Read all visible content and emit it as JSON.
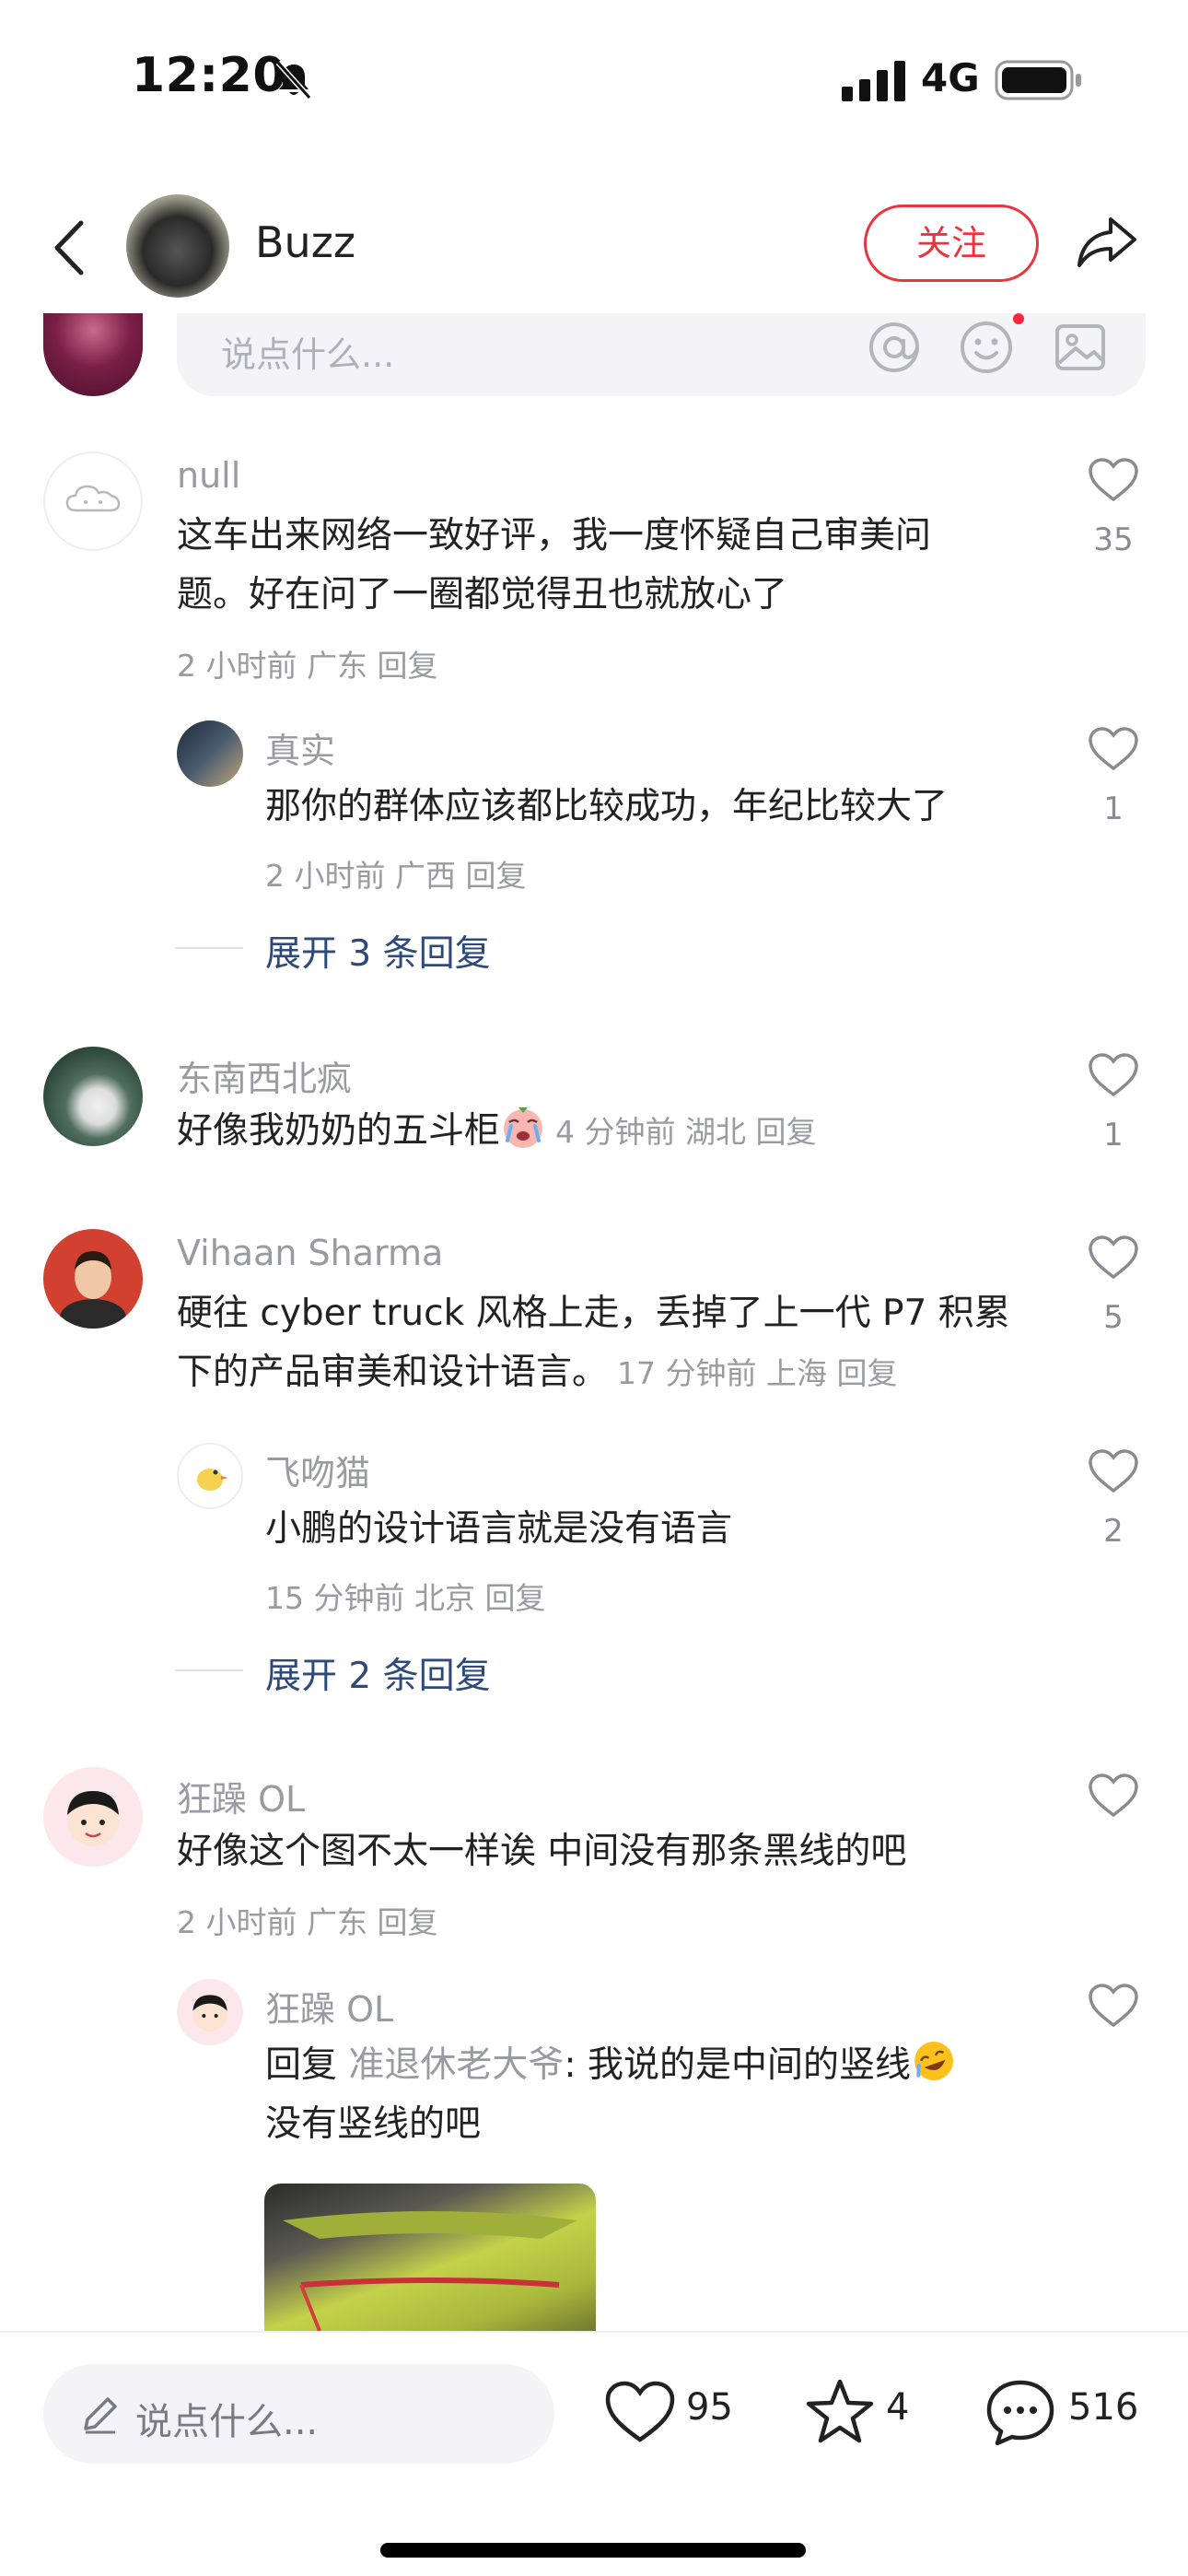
{
  "status_bar": {
    "time": "12:20",
    "network": "4G"
  },
  "header": {
    "author": "Buzz",
    "follow_label": "关注"
  },
  "top_input": {
    "placeholder": "说点什么..."
  },
  "comments": [
    {
      "name": "null",
      "lines": [
        "这车出来网络一致好评，我一度怀疑自己审美问",
        "题。好在问了一圈都觉得丑也就放心了"
      ],
      "meta": "2 小时前  广东  回复",
      "likes": "35",
      "replies": [
        {
          "name": "真实",
          "text": "那你的群体应该都比较成功，年纪比较大了",
          "meta": "2 小时前  广西  回复",
          "likes": "1"
        }
      ],
      "expand": "展开 3 条回复"
    },
    {
      "name": "东南西北疯",
      "text": "好像我奶奶的五斗柜",
      "meta": "4 分钟前  湖北  回复",
      "likes": "1"
    },
    {
      "name": "Vihaan Sharma",
      "lines": [
        "硬往 cyber truck 风格上走，丢掉了上一代 P7 积累",
        "下的产品审美和设计语言。"
      ],
      "meta": "17 分钟前  上海  回复",
      "likes": "5",
      "replies": [
        {
          "name": "飞吻猫",
          "text": "小鹏的设计语言就是没有语言",
          "meta": "15 分钟前  北京  回复",
          "likes": "2"
        }
      ],
      "expand": "展开 2 条回复"
    },
    {
      "name": "狂躁 OL",
      "text": "好像这个图不太一样诶 中间没有那条黑线的吧",
      "meta": "2 小时前  广东  回复",
      "likes": "",
      "replies": [
        {
          "name": "狂躁 OL",
          "reply_prefix": "回复",
          "reply_target": "准退休老大爷",
          "text": ": 我说的是中间的竖线",
          "text2": "没有竖线的吧",
          "likes": ""
        }
      ]
    }
  ],
  "bottom_bar": {
    "placeholder": "说点什么...",
    "likes": "95",
    "stars": "4",
    "comments": "516"
  },
  "colors": {
    "accent": "#e8353f",
    "expand_link": "#2e4a7a",
    "muted": "#9a9aa2"
  }
}
